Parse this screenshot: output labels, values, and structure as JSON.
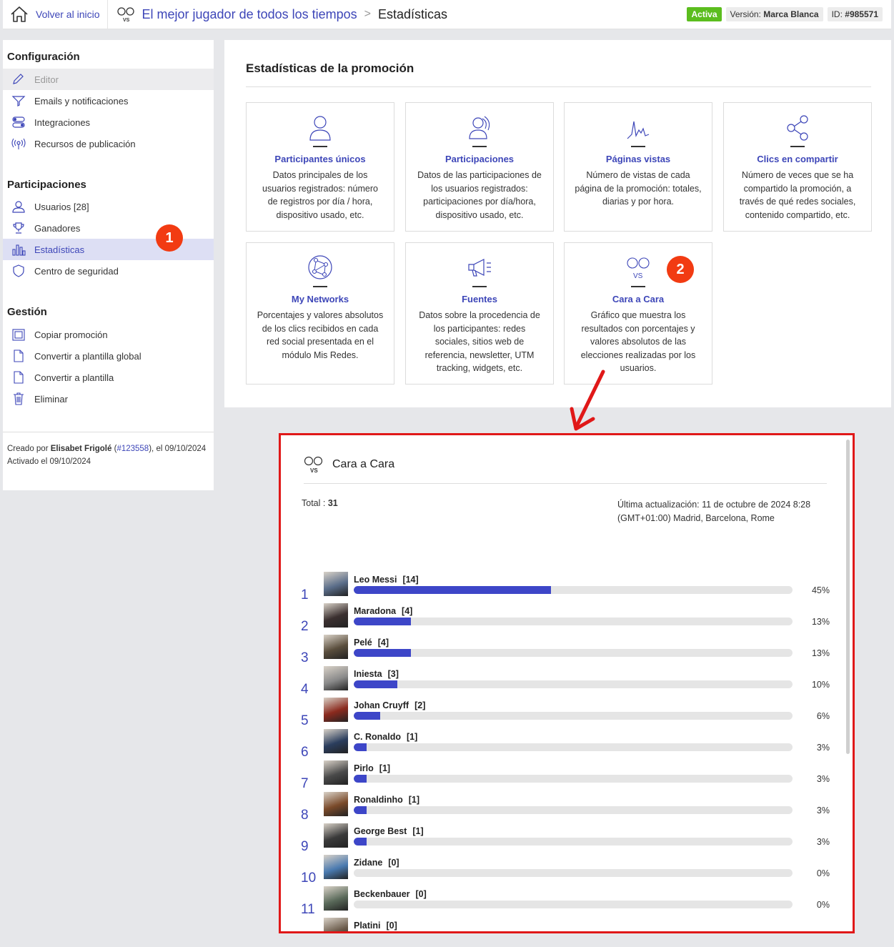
{
  "topbar": {
    "home_label": "Volver al inicio",
    "promo_title": "El mejor jugador de todos los tiempos",
    "separator": ">",
    "current": "Estadísticas",
    "status": "Activa",
    "version_label": "Versión:",
    "version_value": "Marca Blanca",
    "id_label": "ID:",
    "id_value": "#985571"
  },
  "sidebar": {
    "config_heading": "Configuración",
    "config_items": [
      "Editor",
      "Emails y notificaciones",
      "Integraciones",
      "Recursos de publicación"
    ],
    "part_heading": "Participaciones",
    "part_items": [
      "Usuarios [28]",
      "Ganadores",
      "Estadísticas",
      "Centro de seguridad"
    ],
    "gestion_heading": "Gestión",
    "gestion_items": [
      "Copiar promoción",
      "Convertir a plantilla global",
      "Convertir a plantilla",
      "Eliminar"
    ],
    "footer": {
      "created_by": "Creado por",
      "author": "Elisabet Frigolé",
      "author_id_open": "(",
      "author_id": "#123558",
      "created_on": "), el 09/10/2024",
      "activated": "Activado el 09/10/2024"
    }
  },
  "annotations": {
    "one": "1",
    "two": "2"
  },
  "main": {
    "title": "Estadísticas de la promoción",
    "cards": [
      {
        "icon": "user-icon",
        "title": "Participantes únicos",
        "desc": "Datos principales de los usuarios registrados: número de registros por día / hora, dispositivo usado, etc."
      },
      {
        "icon": "participations-icon",
        "title": "Participaciones",
        "desc": "Datos de las participaciones de los usuarios registrados: participaciones por día/hora, dispositivo usado, etc."
      },
      {
        "icon": "pageviews-icon",
        "title": "Páginas vistas",
        "desc": "Número de vistas de cada página de la promoción: totales, diarias y por hora."
      },
      {
        "icon": "share-icon",
        "title": "Clics en compartir",
        "desc": "Número de veces que se ha compartido la promoción, a través de qué redes sociales, contenido compartido, etc."
      },
      {
        "icon": "network-icon",
        "title": "My Networks",
        "desc": "Porcentajes y valores absolutos de los clics recibidos en cada red social presentada en el módulo Mis Redes."
      },
      {
        "icon": "megaphone-icon",
        "title": "Fuentes",
        "desc": "Datos sobre la procedencia de los participantes: redes sociales, sitios web de referencia, newsletter, UTM tracking, widgets, etc."
      },
      {
        "icon": "versus-icon",
        "title": "Cara a Cara",
        "desc": "Gráfico que muestra los resultados con porcentajes y valores absolutos de las elecciones realizadas por los usuarios."
      }
    ]
  },
  "cara_a_cara": {
    "title": "Cara a Cara",
    "total_label": "Total :",
    "total_value": "31",
    "update_text": "Última actualización: 11 de octubre de 2024 8:28 (GMT+01:00) Madrid, Barcelona, Rome"
  },
  "chart_data": {
    "type": "bar",
    "categories": [
      "Leo Messi",
      "Maradona",
      "Pelé",
      "Iniesta",
      "Johan Cruyff",
      "C. Ronaldo",
      "Pirlo",
      "Ronaldinho",
      "George Best",
      "Zidane",
      "Beckenbauer",
      "Platini"
    ],
    "counts": [
      "[14]",
      "[4]",
      "[4]",
      "[3]",
      "[2]",
      "[1]",
      "[1]",
      "[1]",
      "[1]",
      "[0]",
      "[0]",
      "[0]"
    ],
    "values": [
      14,
      4,
      4,
      3,
      2,
      1,
      1,
      1,
      1,
      0,
      0,
      0
    ],
    "percent_labels": [
      "45%",
      "13%",
      "13%",
      "10%",
      "6%",
      "3%",
      "3%",
      "3%",
      "3%",
      "0%",
      "0%",
      ""
    ],
    "percent": [
      45,
      13,
      13,
      10,
      6,
      3,
      3,
      3,
      3,
      0,
      0,
      0
    ],
    "ranks": [
      "1",
      "2",
      "3",
      "4",
      "5",
      "6",
      "7",
      "8",
      "9",
      "10",
      "11",
      ""
    ],
    "avatar_colors": [
      "#5b6e8a",
      "#3b3030",
      "#5a4e3d",
      "#8a8a8a",
      "#8b2a1e",
      "#2b3e5e",
      "#4a4a4a",
      "#7a4a2a",
      "#3a3a3a",
      "#4a7ab0",
      "#5a6a5a",
      "#6a5a4a"
    ],
    "bar_color": "#3d46c8",
    "track_color": "#e5e5e5"
  },
  "colors": {
    "accent": "#3d46b8",
    "status_green": "#5bbd1e",
    "annotation_red": "#f23b12",
    "highlight_border": "#e01818"
  }
}
